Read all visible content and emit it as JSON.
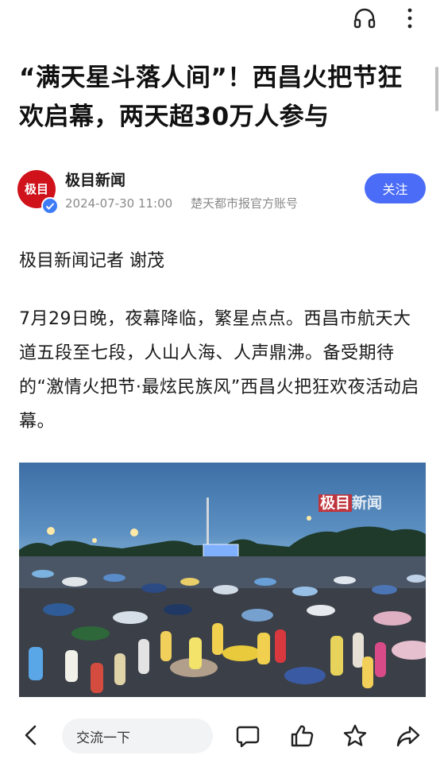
{
  "article": {
    "title": "“满天星斗落人间”！西昌火把节狂欢启幕，两天超30万人参与",
    "author": {
      "name": "极目新闻",
      "avatar_text": "极目",
      "date": "2024-07-30 11:00",
      "source": "楚天都市报官方账号",
      "follow_label": "关注"
    },
    "byline": "极目新闻记者 谢茂",
    "paragraph": "7月29日晚，夜幕降临，繁星点点。西昌市航天大道五段至七段，人山人海、人声鼎沸。备受期待的“激情火把节·最炫民族风”西昌火把狂欢夜活动启幕。",
    "image": {
      "watermark_a": "极目",
      "watermark_b": "新闻"
    }
  },
  "topbar": {
    "icons": [
      "headphone-icon",
      "more-icon"
    ]
  },
  "bottombar": {
    "comment_placeholder": "交流一下",
    "icons": [
      "back-icon",
      "comment-icon",
      "like-icon",
      "star-icon",
      "share-icon"
    ]
  },
  "colors": {
    "accent": "#4a6cf7",
    "brand_red": "#d0121b",
    "meta_gray": "#8a8a8a"
  }
}
